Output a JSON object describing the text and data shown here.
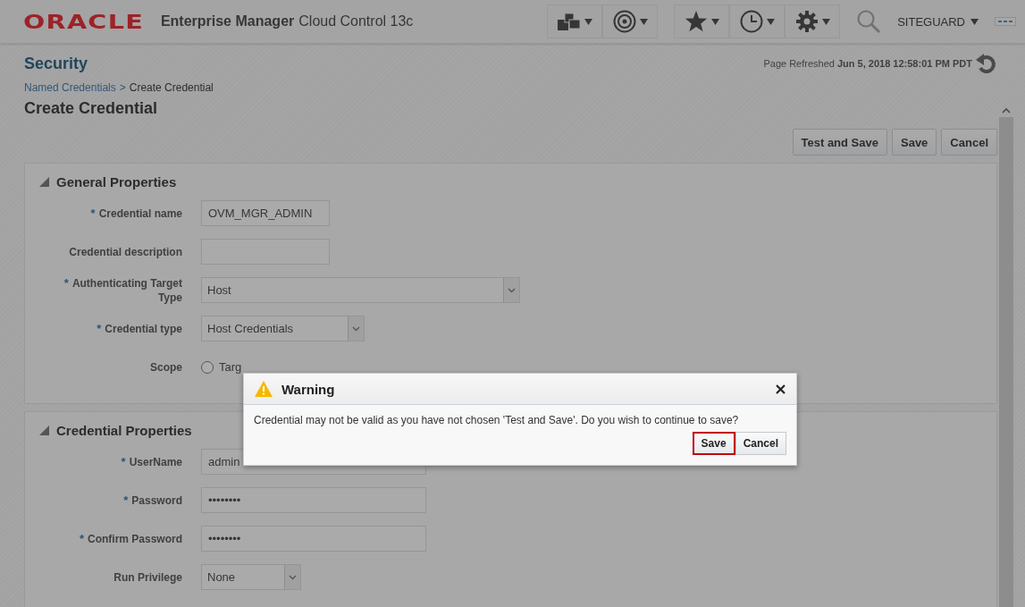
{
  "header": {
    "logo": "ORACLE",
    "product_bold": "Enterprise Manager",
    "product": "Cloud Control 13c",
    "user": "SITEGUARD"
  },
  "page": {
    "title": "Security",
    "refreshed_label": "Page Refreshed",
    "refreshed_time": "Jun 5, 2018 12:58:01 PM PDT",
    "breadcrumb": [
      {
        "label": "Named Credentials",
        "kind": "link"
      },
      {
        "label": ">",
        "kind": "separator"
      },
      {
        "label": "Create Credential",
        "kind": "current"
      }
    ],
    "heading": "Create Credential",
    "buttons": [
      "Test and Save",
      "Save",
      "Cancel"
    ]
  },
  "sections": [
    {
      "title": "General Properties",
      "expanded": true,
      "fields": [
        {
          "label": "Credential name",
          "marker": "*",
          "kind": "text",
          "value": "OVM_MGR_ADMIN"
        },
        {
          "label": "Credential description",
          "kind": "text"
        },
        {
          "label": "Authenticating Target Type",
          "marker": "*",
          "kind": "select",
          "value": "Host"
        },
        {
          "label": "Credential type",
          "marker": "*",
          "kind": "select",
          "value": "Host Credentials"
        },
        {
          "label": "Scope",
          "kind": "radio",
          "value": "Targ",
          "checked": false
        }
      ]
    },
    {
      "title": "Credential Properties",
      "expanded": true,
      "fields": [
        {
          "label": "UserName",
          "marker": "*",
          "kind": "text",
          "value": "admin"
        },
        {
          "label": "Password",
          "marker": "*",
          "kind": "password",
          "value": "••••••••"
        },
        {
          "label": "Confirm Password",
          "marker": "*",
          "kind": "password",
          "value": "••••••••"
        },
        {
          "label": "Run Privilege",
          "kind": "select",
          "value": "None"
        }
      ]
    }
  ],
  "dialog": {
    "title": "Warning",
    "message": "Credential may not be valid as you have not chosen 'Test and Save'. Do you wish to continue to save?",
    "buttons": [
      {
        "label": "Save",
        "focused": true
      },
      {
        "label": "Cancel",
        "focused": false
      }
    ]
  }
}
